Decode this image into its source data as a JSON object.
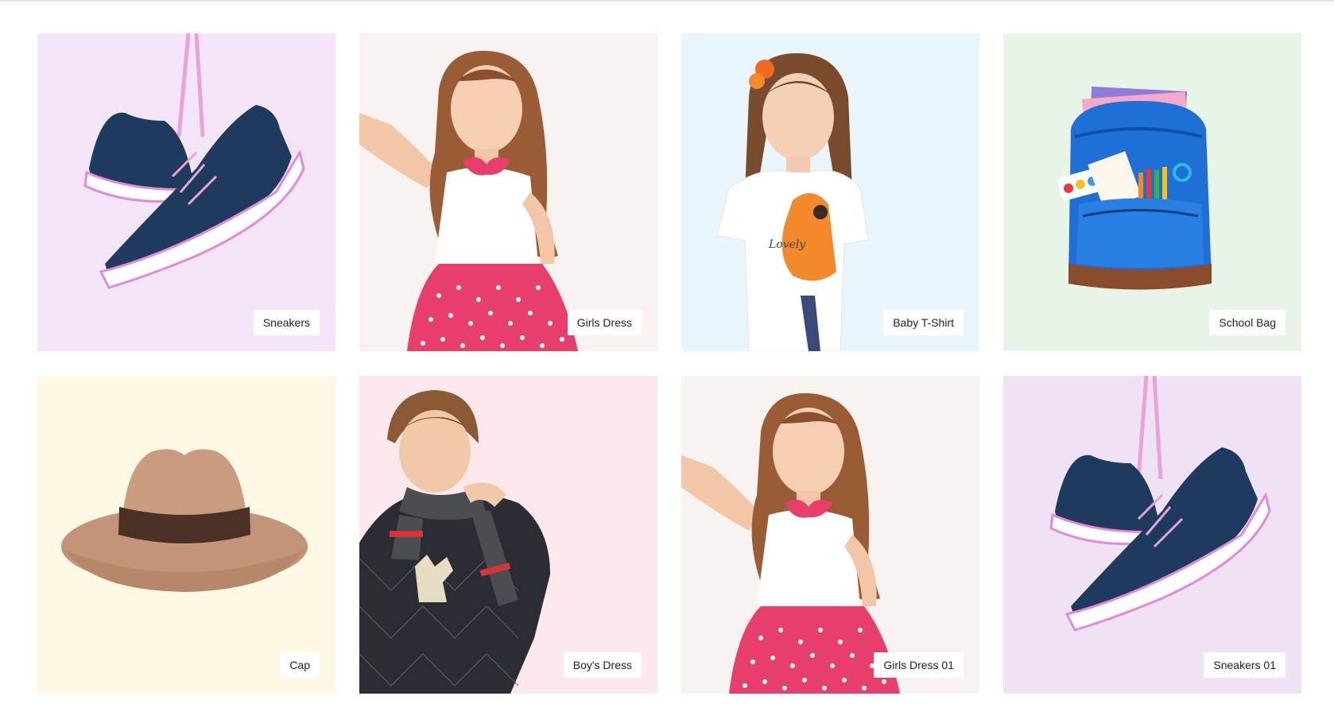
{
  "products": [
    {
      "label": "Sneakers",
      "bg": "#f3e4f7",
      "icon": "sneakers-icon"
    },
    {
      "label": "Girls Dress",
      "bg": "#f8f3f0",
      "icon": "girl-in-dress-icon"
    },
    {
      "label": "Baby T-Shirt",
      "bg": "#e8f5fa",
      "icon": "girl-in-tshirt-icon"
    },
    {
      "label": "School Bag",
      "bg": "#e9f4e8",
      "icon": "school-bag-icon"
    },
    {
      "label": "Cap",
      "bg": "#fef8e4",
      "icon": "hat-icon"
    },
    {
      "label": "Boy's Dress",
      "bg": "#fde9ed",
      "icon": "boy-in-sweater-icon"
    },
    {
      "label": "Girls Dress 01",
      "bg": "#f8f3f0",
      "icon": "girl-in-dress-icon"
    },
    {
      "label": "Sneakers 01",
      "bg": "#efe2f5",
      "icon": "sneakers-icon"
    }
  ]
}
